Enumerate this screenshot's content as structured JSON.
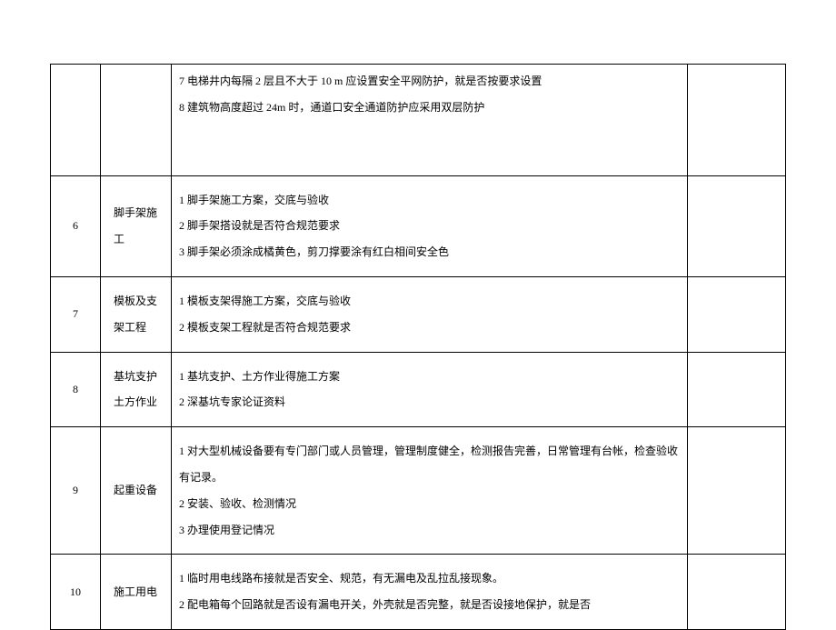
{
  "rows": [
    {
      "num": "",
      "category": "",
      "items": [
        "7 电梯井内每隔   2 层且不大于   10 m 应设置安全平网防护，就是否按要求设置",
        "8 建筑物高度超过   24m  时，通道口安全通道防护应采用双层防护"
      ]
    },
    {
      "num": "6",
      "category": "    脚手架施工",
      "items": [
        "1 脚手架施工方案，交底与验收",
        "2 脚手架搭设就是否符合规范要求",
        "3 脚手架必须涂成橘黄色，剪刀撑要涂有红白相间安全色"
      ]
    },
    {
      "num": "7",
      "category": "    模板及支架工程",
      "items": [
        "1 模板支架得施工方案，交底与验收",
        "2 模板支架工程就是否符合规范要求"
      ]
    },
    {
      "num": "8",
      "category": "    基坑支护土方作业",
      "items": [
        "1 基坑支护、土方作业得施工方案",
        "2 深基坑专家论证资料"
      ]
    },
    {
      "num": "9",
      "category": "起重设备",
      "items": [
        "1  对大型机械设备要有专门部门或人员管理，管理制度健全，检测报告完善，日常管理有台帐，检查验收有记录。",
        "2 安装、验收、检测情况",
        "3 办理使用登记情况"
      ]
    },
    {
      "num": "10",
      "category": "施工用电",
      "items": [
        "1  临时用电线路布接就是否安全、规范，有无漏电及乱拉乱接现象。",
        "2  配电箱每个回路就是否设有漏电开关，外壳就是否完整，就是否设接地保护，就是否"
      ]
    }
  ]
}
